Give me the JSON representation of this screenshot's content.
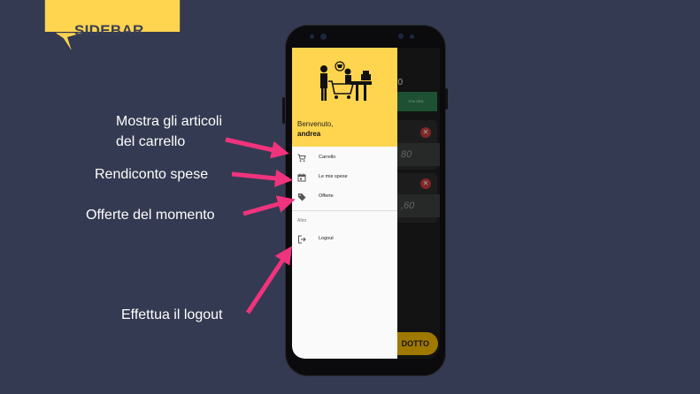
{
  "banner": {
    "title": "SIDEBAR"
  },
  "annotations": {
    "cart_line1": "Mostra gli articoli",
    "cart_line2": "del carrello",
    "expenses": "Rendiconto spese",
    "offers": "Offerte del momento",
    "logout": "Effettua il logout"
  },
  "drawer": {
    "welcome": "Benvenuto,",
    "username": "andrea",
    "items": [
      {
        "label": "Carrello",
        "icon": "cart-icon"
      },
      {
        "label": "Le mie spese",
        "icon": "calendar-icon"
      },
      {
        "label": "Offerte",
        "icon": "tag-icon"
      }
    ],
    "section_label": "Altro",
    "logout_label": "Logout"
  },
  "background_app": {
    "top_number": "0",
    "green_button": "STA ORA",
    "price1": "80",
    "price2": ",60",
    "bottom_button": "DOTTO"
  },
  "colors": {
    "page_bg": "#343a51",
    "banner_yellow": "#ffd54f",
    "arrow_pink": "#f0337d",
    "drawer_header": "#ffd54f"
  }
}
